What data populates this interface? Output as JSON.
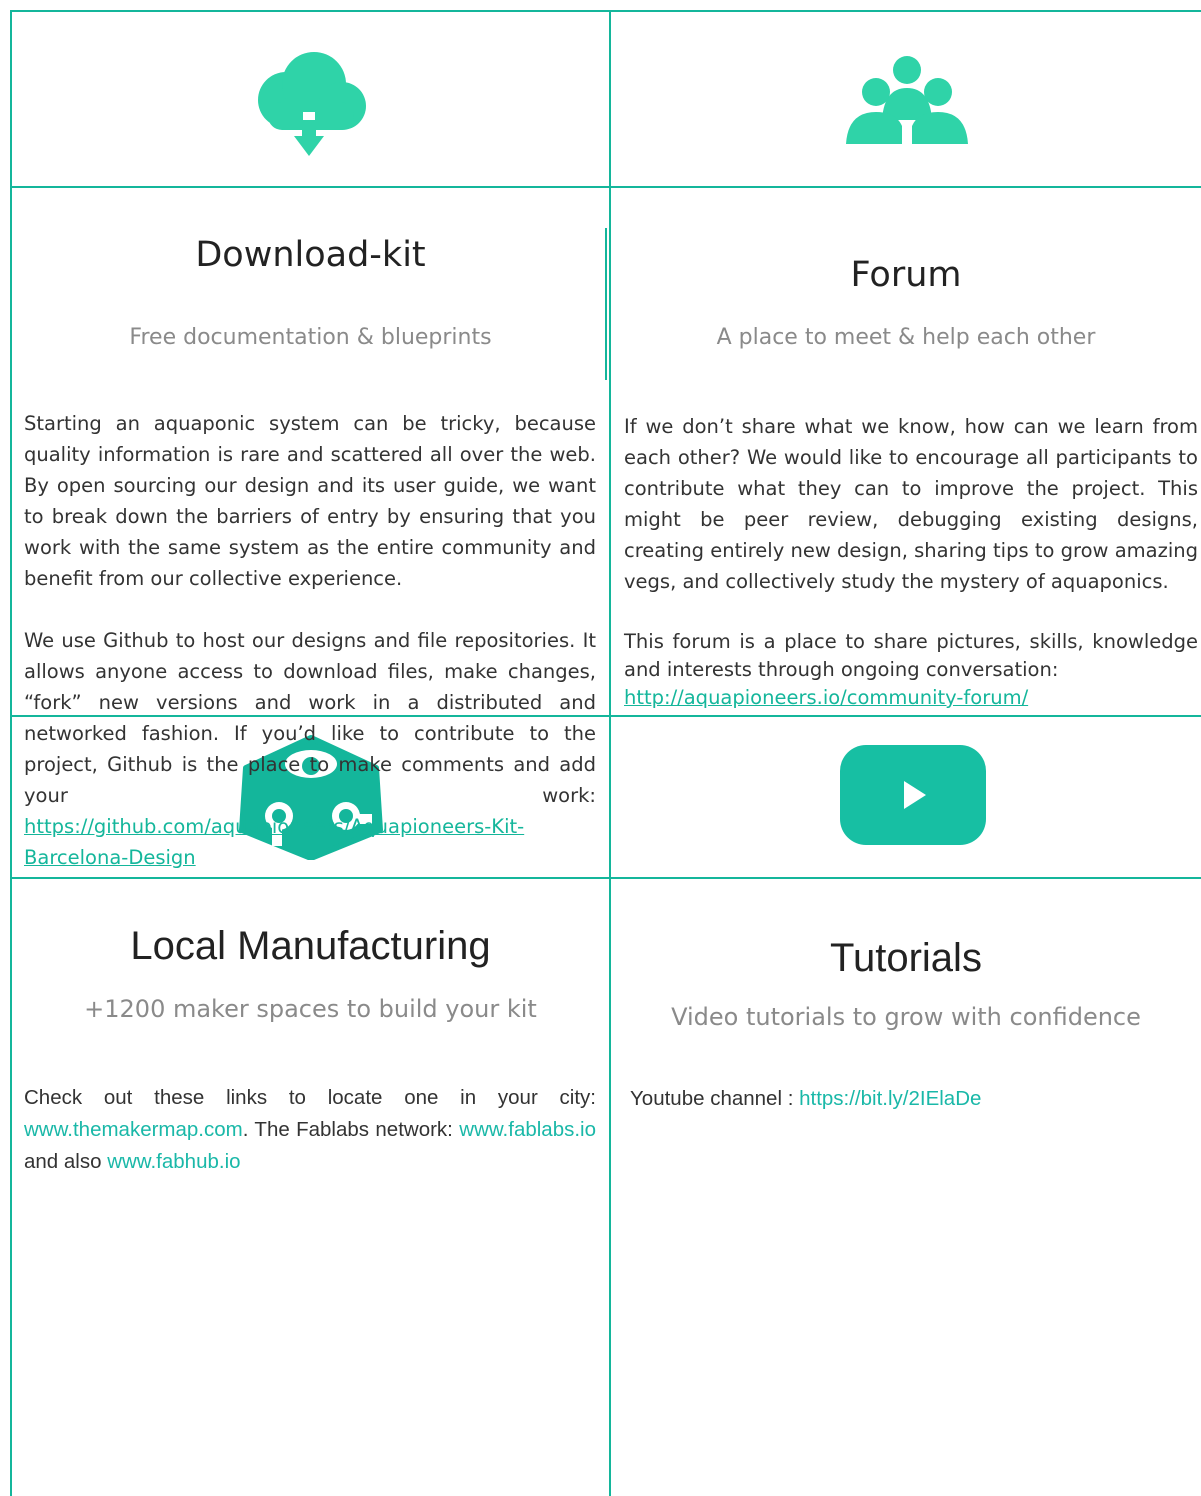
{
  "colors": {
    "accent": "#2fd3a8",
    "grid": "#14b69b",
    "teal": "#17bfa3"
  },
  "download": {
    "icon": "cloud-download-icon",
    "title": "Download-kit",
    "subtitle": "Free documentation & blueprints",
    "p1": "Starting an aquaponic system can be tricky, because quality information is rare and scattered all over the web. By open sourcing our design and its user guide, we want to break down the barriers of entry by ensuring that you work with the same system as the entire community and benefit from our collective experience.",
    "p2": "We use Github to host our designs and file repositories. It allows anyone access to download files, make changes, “fork” new versions and work in a distributed and networked fashion. If you’d like to contribute to the project, Github is the place to make comments and add your work:",
    "link": "https://github.com/aquapioneers/Aquapioneers-Kit-Barcelona-Design"
  },
  "forum": {
    "icon": "community-people-icon",
    "title": "Forum",
    "subtitle": "A place to meet & help each other",
    "p1": "If we don’t share what we know, how can we learn from each other? We would like to encourage all participants to contribute what they can to improve the project. This might be peer review, debugging existing designs, creating entirely new design, sharing tips to grow amazing vegs, and collectively study the  mystery of aquaponics.",
    "p2": "This forum is a place to share pictures, skills, knowledge and interests through ongoing conversation:",
    "link": "http://aquapioneers.io/community-forum/"
  },
  "manufacturing": {
    "icon": "fablab-logo-icon",
    "title": "Local Manufacturing",
    "subtitle": "+1200 maker spaces to build your kit",
    "text1": "Check out these links to locate one in your city:",
    "link1": "www.themakermap.com",
    "text2": ". The Fablabs network:",
    "link2": "www.fablabs.io",
    "text3": " and also ",
    "link3": "www.fabhub.io"
  },
  "tutorials": {
    "icon": "youtube-play-icon",
    "title": "Tutorials",
    "subtitle": "Video tutorials to grow with confidence",
    "text": "Youtube channel : ",
    "link": "https://bit.ly/2IElaDe"
  }
}
